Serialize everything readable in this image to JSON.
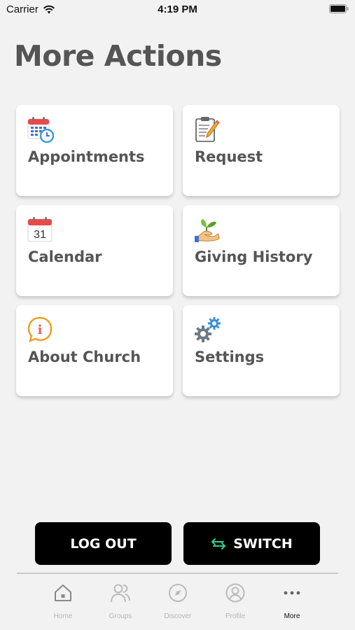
{
  "status_bar": {
    "carrier": "Carrier",
    "time": "4:19 PM"
  },
  "page": {
    "title": "More Actions"
  },
  "actions": [
    {
      "label": "Appointments",
      "icon": "calendar-clock-icon"
    },
    {
      "label": "Request",
      "icon": "clipboard-pen-icon"
    },
    {
      "label": "Calendar",
      "icon": "calendar-icon",
      "date": "31"
    },
    {
      "label": "Giving History",
      "icon": "plant-hand-icon"
    },
    {
      "label": "About Church",
      "icon": "info-bubble-icon",
      "glyph": "i"
    },
    {
      "label": "Settings",
      "icon": "gears-icon"
    }
  ],
  "buttons": {
    "logout": "LOG OUT",
    "switch": "SWITCH"
  },
  "tabs": [
    {
      "label": "Home",
      "icon": "home-icon"
    },
    {
      "label": "Groups",
      "icon": "groups-icon"
    },
    {
      "label": "Discover",
      "icon": "compass-icon"
    },
    {
      "label": "Profile",
      "icon": "profile-icon"
    },
    {
      "label": "More",
      "icon": "more-dots-icon",
      "active": true
    }
  ],
  "colors": {
    "background": "#f2f2f2",
    "button": "#000000",
    "switch_accent": "#2ecc8f"
  }
}
